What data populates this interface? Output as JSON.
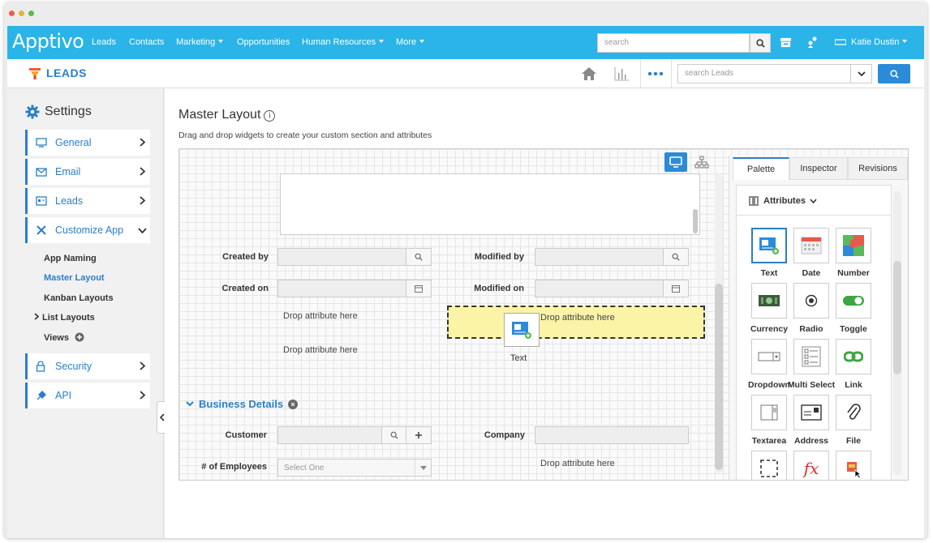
{
  "app": {
    "brand": "Apptivo",
    "nav": [
      {
        "label": "Leads",
        "dropdown": false
      },
      {
        "label": "Contacts",
        "dropdown": false
      },
      {
        "label": "Marketing",
        "dropdown": true
      },
      {
        "label": "Opportunities",
        "dropdown": false
      },
      {
        "label": "Human Resources",
        "dropdown": true
      },
      {
        "label": "More",
        "dropdown": true
      }
    ],
    "search_placeholder": "search",
    "user": "Katie Dustin",
    "accent": "#2ab4e8"
  },
  "subbar": {
    "title": "LEADS",
    "search_placeholder": "search Leads",
    "icons": [
      "home-icon",
      "bar-chart-icon",
      "more-dots-icon"
    ]
  },
  "sidebar": {
    "heading": "Settings",
    "items": [
      {
        "label": "General",
        "icon": "monitor-icon"
      },
      {
        "label": "Email",
        "icon": "envelope-icon"
      },
      {
        "label": "Leads",
        "icon": "id-card-icon"
      },
      {
        "label": "Customize App",
        "icon": "tools-icon"
      }
    ],
    "sub_items": [
      {
        "label": "App Naming"
      },
      {
        "label": "Master Layout"
      },
      {
        "label": "Kanban Layouts"
      },
      {
        "label": "List Layouts"
      },
      {
        "label": "Views"
      }
    ],
    "bottom_items": [
      {
        "label": "Security",
        "icon": "lock-icon"
      },
      {
        "label": "API",
        "icon": "plug-icon"
      }
    ]
  },
  "main": {
    "title": "Master Layout",
    "subtitle": "Drag and drop widgets to create your custom section and attributes",
    "fields": {
      "created_by": "Created by",
      "modified_by": "Modified by",
      "created_on": "Created on",
      "modified_on": "Modified on",
      "customer": "Customer",
      "company": "Company",
      "employees": "# of Employees",
      "select_placeholder": "Select One"
    },
    "drop_text": "Drop attribute here",
    "drag_widget_label": "Text",
    "section_title": "Business Details"
  },
  "palette": {
    "tabs": [
      "Palette",
      "Inspector",
      "Revisions"
    ],
    "group": "Attributes",
    "widgets": [
      "Text",
      "Date",
      "Number",
      "Currency",
      "Radio",
      "Toggle",
      "Dropdown",
      "Multi Select",
      "Link",
      "Textarea",
      "Address",
      "File",
      "",
      "",
      ""
    ]
  }
}
